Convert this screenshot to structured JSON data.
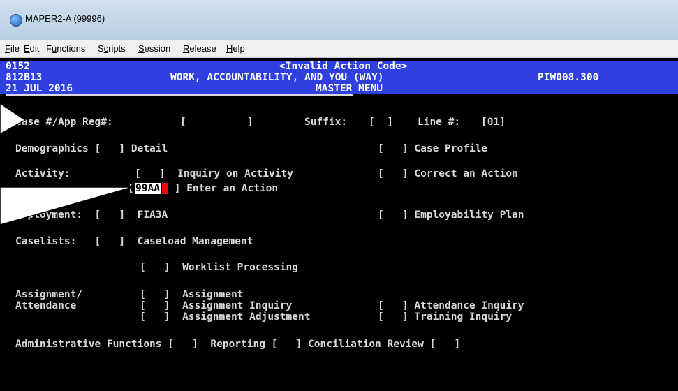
{
  "window": {
    "title": "MAPER2-A (99996)"
  },
  "menu": [
    {
      "label": "File"
    },
    {
      "label": "Edit"
    },
    {
      "label": "Functions"
    },
    {
      "label": "Scripts"
    },
    {
      "label": "Session"
    },
    {
      "label": "Release"
    },
    {
      "label": "Help"
    }
  ],
  "header": {
    "code": "0152",
    "message": "<Invalid Action Code>",
    "id": "812B13",
    "system": "WORK, ACCOUNTABILITY, AND YOU (WAY)",
    "screen_id": "PIW008.300",
    "date": "21 JUL 2016",
    "menu_title": "MASTER MENU"
  },
  "case_row": {
    "case_label": "Case #/App Reg#:",
    "case_field": "[          ]",
    "suffix_label": "Suffix:",
    "suffix_field": "[  ]",
    "line_label": "Line #:",
    "line_field": "[01]"
  },
  "rows": {
    "demographics": "Demographics [   ] Detail",
    "case_profile": "[   ] Case Profile",
    "activity_label": "Activity:",
    "inquiry_activity": "[   ]  Inquiry on Activity",
    "correct_action": "[   ] Correct an Action",
    "enter_action_open": "[",
    "enter_action_value": "99AA",
    "enter_action_rest": " ] Enter an Action",
    "employment": "Employment:  [   ]  FIA3A",
    "employability_plan": "[   ] Employability Plan",
    "caselists": "Caselists:   [   ]  Caseload Management",
    "worklist": "[   ]  Worklist Processing",
    "assignment_label": "Assignment/",
    "attendance_label": "Attendance",
    "assignment": "[   ]  Assignment",
    "assignment_inquiry": "[   ]  Assignment Inquiry",
    "assignment_adjustment": "[   ]  Assignment Adjustment",
    "attendance_inquiry": "[   ] Attendance Inquiry",
    "training_inquiry": "[   ] Training Inquiry",
    "admin": "Administrative Functions [   ]  Reporting [   ] Conciliation Review [   ]"
  }
}
